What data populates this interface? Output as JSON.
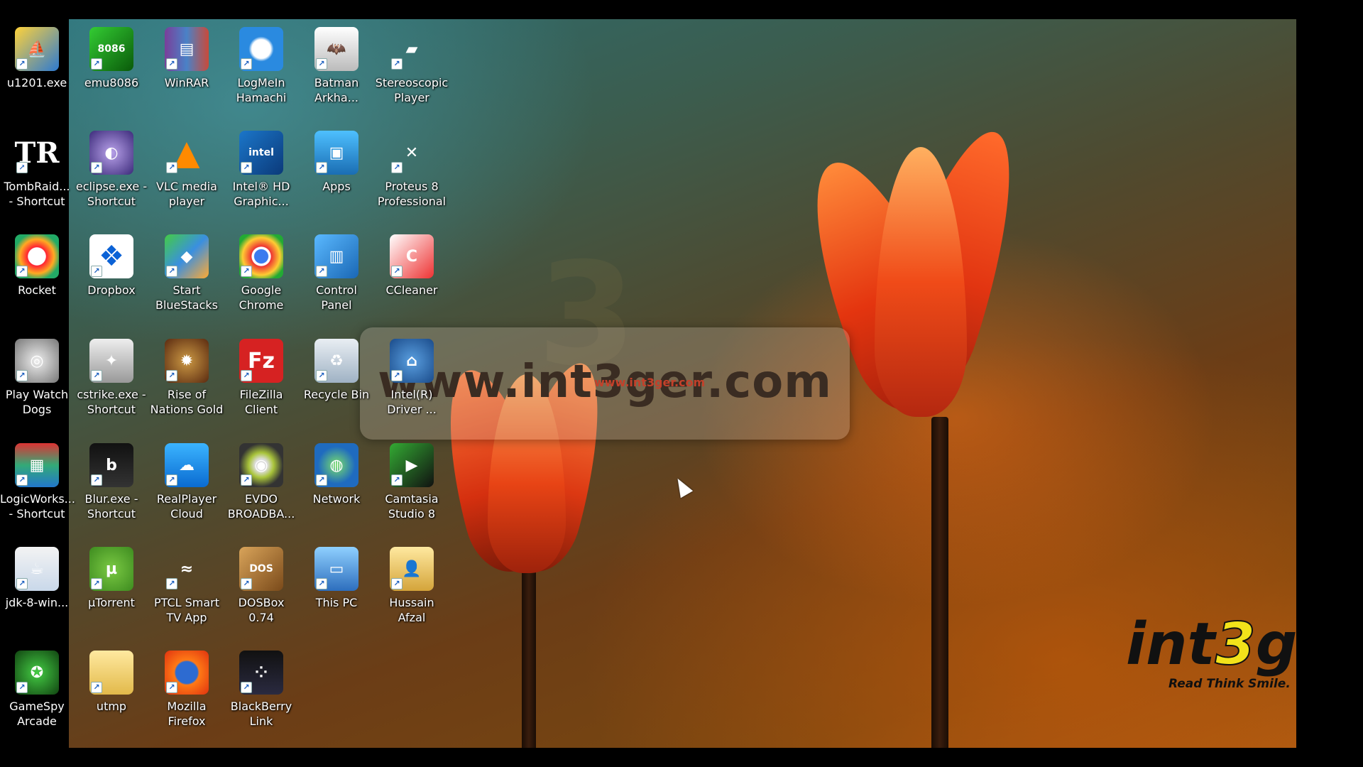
{
  "watermark": {
    "text": "www.int3ger.com",
    "small": "www.int3ger.com"
  },
  "logo": {
    "brand_pre": "int",
    "brand_three": "3",
    "brand_post": "ge",
    "tagline": "Read Think Smile."
  },
  "colors": {
    "accent_orange": "#e8441a",
    "logo_yellow": "#f2e21a",
    "wallpaper_dark": "#3b5d4f"
  },
  "icons": [
    {
      "label": "u1201.exe",
      "icon": "gold-sail-icon"
    },
    {
      "label": "TombRaid...\n- Shortcut",
      "icon": "tr-icon"
    },
    {
      "label": "Rocket",
      "icon": "rocket-ring-icon"
    },
    {
      "label": "Play Watch\nDogs",
      "icon": "watchdogs-icon"
    },
    {
      "label": "LogicWorks...\n- Shortcut",
      "icon": "logicworks-icon"
    },
    {
      "label": "jdk-8-win...",
      "icon": "java-icon"
    },
    {
      "label": "GameSpy\nArcade",
      "icon": "gamespy-icon"
    },
    {
      "label": "emu8086",
      "icon": "chip-icon"
    },
    {
      "label": "eclipse.exe -\nShortcut",
      "icon": "eclipse-icon"
    },
    {
      "label": "Dropbox",
      "icon": "dropbox-icon"
    },
    {
      "label": "cstrike.exe -\nShortcut",
      "icon": "counterstrike-icon"
    },
    {
      "label": "Blur.exe -\nShortcut",
      "icon": "blur-icon"
    },
    {
      "label": "µTorrent",
      "icon": "utorrent-icon"
    },
    {
      "label": "utmp",
      "icon": "folder-icon"
    },
    {
      "label": "WinRAR",
      "icon": "winrar-icon"
    },
    {
      "label": "VLC media\nplayer",
      "icon": "vlc-cone-icon"
    },
    {
      "label": "Start\nBlueStacks",
      "icon": "bluestacks-icon"
    },
    {
      "label": "Rise of\nNations Gold",
      "icon": "rise-of-nations-icon"
    },
    {
      "label": "RealPlayer\nCloud",
      "icon": "realplayer-cloud-icon"
    },
    {
      "label": "PTCL Smart\nTV App",
      "icon": "ptcl-icon"
    },
    {
      "label": "Mozilla\nFirefox",
      "icon": "firefox-icon"
    },
    {
      "label": "LogMeIn\nHamachi",
      "icon": "hamachi-icon"
    },
    {
      "label": "Intel® HD\nGraphic...",
      "icon": "intel-graphics-icon"
    },
    {
      "label": "Google\nChrome",
      "icon": "chrome-icon"
    },
    {
      "label": "FileZilla\nClient",
      "icon": "filezilla-icon"
    },
    {
      "label": "EVDO\nBROADBA...",
      "icon": "evdo-icon"
    },
    {
      "label": "DOSBox 0.74",
      "icon": "dosbox-icon"
    },
    {
      "label": "BlackBerry\nLink",
      "icon": "blackberry-icon"
    },
    {
      "label": "Batman\nArkha...",
      "icon": "batman-icon"
    },
    {
      "label": "Apps",
      "icon": "apps-icon"
    },
    {
      "label": "Control\nPanel",
      "icon": "control-panel-icon"
    },
    {
      "label": "Recycle Bin",
      "icon": "recycle-bin-icon"
    },
    {
      "label": "Network",
      "icon": "network-globe-icon"
    },
    {
      "label": "This PC",
      "icon": "this-pc-icon"
    },
    {
      "label": "Stereoscopic\nPlayer",
      "icon": "stereoscopic-icon"
    },
    {
      "label": "Proteus 8\nProfessional",
      "icon": "proteus-icon"
    },
    {
      "label": "CCleaner",
      "icon": "ccleaner-icon"
    },
    {
      "label": "Intel(R)\nDriver ...",
      "icon": "intel-driver-icon"
    },
    {
      "label": "Camtasia\nStudio 8",
      "icon": "camtasia-icon"
    },
    {
      "label": "Hussain Afzal",
      "icon": "user-folder-icon"
    }
  ]
}
